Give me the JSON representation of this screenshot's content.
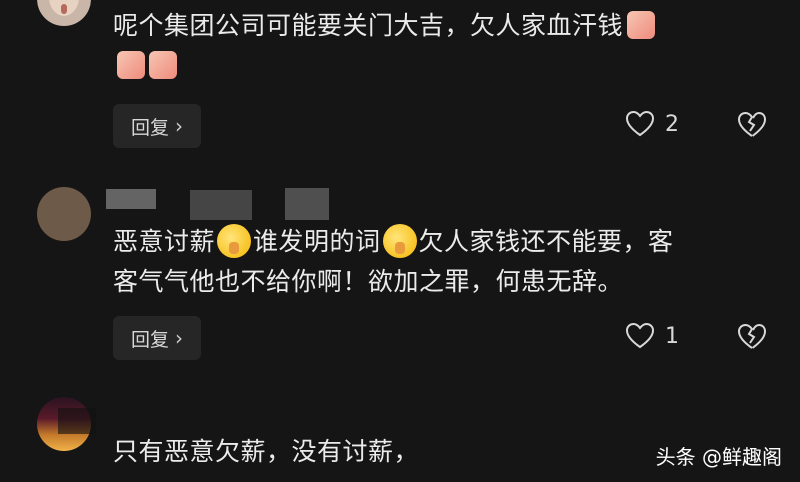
{
  "comments": [
    {
      "text_line1": "呢个集团公司可能要关门大吉，欠人家血汗钱",
      "reply_label": "回复",
      "likes": "2"
    },
    {
      "text_part1": "恶意讨薪",
      "text_part2": "谁发明的词",
      "text_part3": "欠人家钱还不能要，客",
      "text_line2": "客气气他也不给你啊！欲加之罪，何患无辞。",
      "reply_label": "回复",
      "likes": "1"
    },
    {
      "text_line1": "只有恶意欠薪，没有讨薪，"
    }
  ],
  "watermark": "头条 @鲜趣阁",
  "colors": {
    "background": "#151515",
    "button": "#262626",
    "text": "#ebebeb"
  },
  "icons": [
    "prayer-hands-emoji",
    "shushing-face-emoji",
    "heart-outline-icon",
    "broken-heart-icon",
    "chevron-right-icon"
  ]
}
